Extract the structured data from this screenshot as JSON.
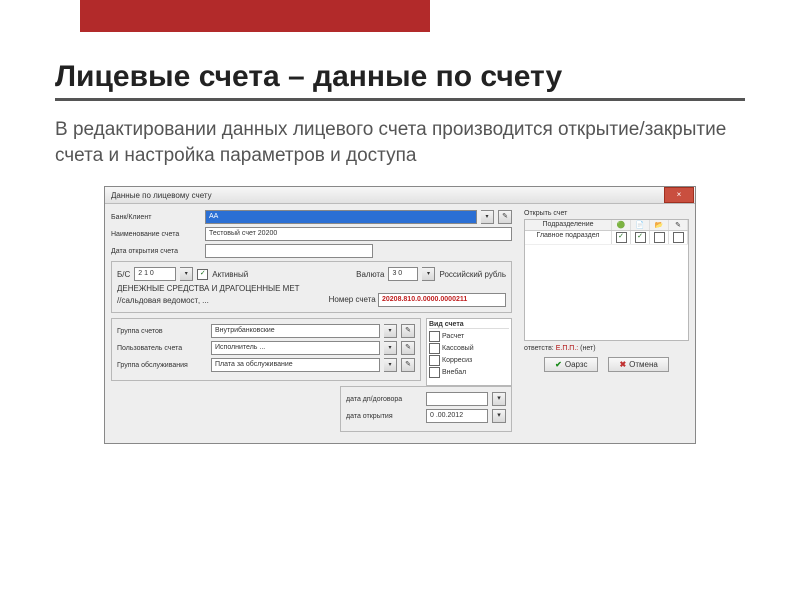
{
  "slide": {
    "title": "Лицевые счета – данные по счету",
    "subtitle": "В редактировании данных лицевого счета производится открытие/закрытие счета и настройка параметров и доступа"
  },
  "window": {
    "title": "Данные по лицевому счету",
    "close": "×"
  },
  "top_fields": {
    "client_label": "Банк/Клиент",
    "client_value": "АА",
    "name_label": "Наименование счета",
    "name_value": "Тестовый счет 20200",
    "purpose_label": "Дата открытия счета",
    "purpose_value": ""
  },
  "account": {
    "bs_label": "Б/С",
    "bs_value": "2 1 0",
    "active_checked": "✓",
    "active_label": "Активный",
    "currency_label": "Валюта",
    "currency_code": "3 0",
    "currency_name": "Российский рубль",
    "desc1": "ДЕНЕЖНЫЕ СРЕДСТВА И ДРАГОЦЕННЫЕ МЕТ",
    "desc2": "//сальдовая ведомост‚ ...",
    "number_label": "Номер счета",
    "number_value": "20208.810.0.0000.0000211"
  },
  "params": {
    "group_label": "Группа счетов",
    "group_value": "Внутрибанковские",
    "user_label": "Пользователь счета",
    "user_value": "Исполнитель ...",
    "close_label": "Группа обслуживания",
    "close_value": "Плата за обслуживание"
  },
  "cat_list": {
    "header": "Вид счета",
    "items": [
      "Расчет",
      "Кассовый",
      "Корресиз",
      "Внебал"
    ]
  },
  "dates": {
    "contract_label": "дата дп/договора",
    "contract_value": "",
    "open_label": "дата открытия",
    "open_value": "0 .00.2012"
  },
  "right": {
    "tab1": "Открыть счет",
    "col_name": "Подразделение",
    "row1": "Главное подраздел",
    "responsible_label": "ответств: ",
    "responsible_name": "Е.П.П.:",
    "responsible_tail": " (нет)"
  },
  "buttons": {
    "ok": "Оарзс",
    "cancel": "Отмена"
  }
}
